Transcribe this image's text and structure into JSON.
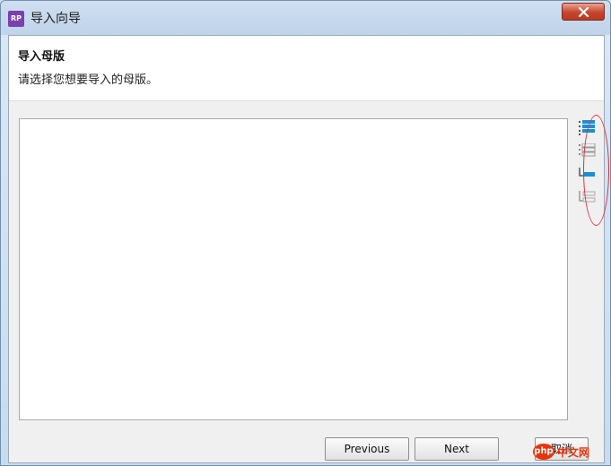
{
  "window": {
    "title": "导入向导",
    "app_icon_text": "RP"
  },
  "header": {
    "section_title": "导入母版",
    "description": "请选择您想要导入的母版。"
  },
  "side_tools": [
    {
      "icon": "tree-expand-all-icon"
    },
    {
      "icon": "list-select-all-icon"
    },
    {
      "icon": "tree-collapse-icon"
    },
    {
      "icon": "list-deselect-icon"
    }
  ],
  "buttons": {
    "previous": "Previous",
    "next": "Next",
    "cancel": "取消"
  },
  "watermark": {
    "brand": "php",
    "text": "中文网"
  },
  "colors": {
    "accent_blue": "#1a8fd8",
    "annotation_red": "#e0303a",
    "close_red": "#c9452d"
  }
}
